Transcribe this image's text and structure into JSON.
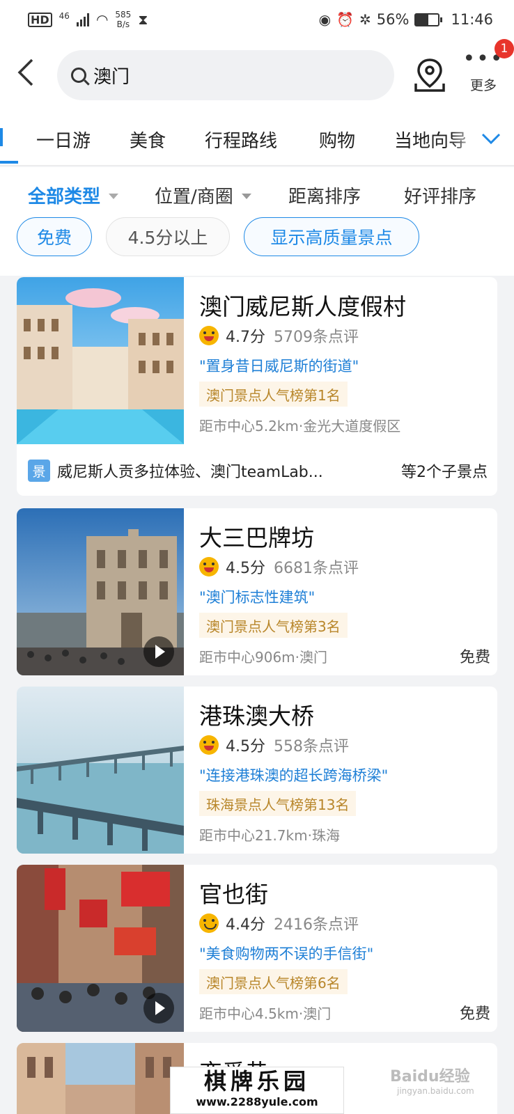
{
  "status_bar": {
    "hd": "HD",
    "network": "46",
    "speed_value": "585",
    "speed_unit": "B/s",
    "battery": "56%",
    "time": "11:46",
    "battery_level": 0.56
  },
  "header": {
    "search_value": "澳门",
    "more_label": "更多",
    "badge_count": "1"
  },
  "tabs": [
    "一日游",
    "美食",
    "行程路线",
    "购物",
    "当地向导"
  ],
  "filters": {
    "sorts": [
      {
        "label": "全部类型",
        "active": true,
        "dropdown": true
      },
      {
        "label": "位置/商圈",
        "active": false,
        "dropdown": true
      },
      {
        "label": "距离排序",
        "active": false,
        "dropdown": false
      },
      {
        "label": "好评排序",
        "active": false,
        "dropdown": false
      }
    ],
    "chips": [
      {
        "label": "免费",
        "style": "blue"
      },
      {
        "label": "4.5分以上",
        "style": "gray"
      },
      {
        "label": "显示高质量景点",
        "style": "blue"
      }
    ]
  },
  "cards": [
    {
      "name": "澳门威尼斯人度假村",
      "score": "4.7分",
      "reviews": "5709条点评",
      "quote": "\"置身昔日威尼斯的街道\"",
      "rank": "澳门景点人气榜第1名",
      "distance": "距市中心5.2km·金光大道度假区",
      "free": "",
      "sub_icon": "景",
      "sub_text": "威尼斯人贡多拉体验、澳门teamLab...",
      "sub_count": "等2个子景点"
    },
    {
      "name": "大三巴牌坊",
      "score": "4.5分",
      "reviews": "6681条点评",
      "quote": "\"澳门标志性建筑\"",
      "rank": "澳门景点人气榜第3名",
      "distance": "距市中心906m·澳门",
      "free": "免费"
    },
    {
      "name": "港珠澳大桥",
      "score": "4.5分",
      "reviews": "558条点评",
      "quote": "\"连接港珠澳的超长跨海桥梁\"",
      "rank": "珠海景点人气榜第13名",
      "distance": "距市中心21.7km·珠海",
      "free": ""
    },
    {
      "name": "官也街",
      "score": "4.4分",
      "reviews": "2416条点评",
      "quote": "\"美食购物两不误的手信街\"",
      "rank": "澳门景点人气榜第6名",
      "distance": "距市中心4.5km·澳门",
      "free": "免费"
    },
    {
      "name": "恋爱巷"
    }
  ],
  "watermark": {
    "title": "棋牌乐园",
    "url": "www.2288yule.com",
    "baidu": "Baidu经验",
    "baidu_url": "jingyan.baidu.com"
  },
  "colors": {
    "accent": "#1e89e6",
    "rank_bg": "#fdf5e8",
    "rank_text": "#b8862a",
    "badge": "#e8342b"
  }
}
